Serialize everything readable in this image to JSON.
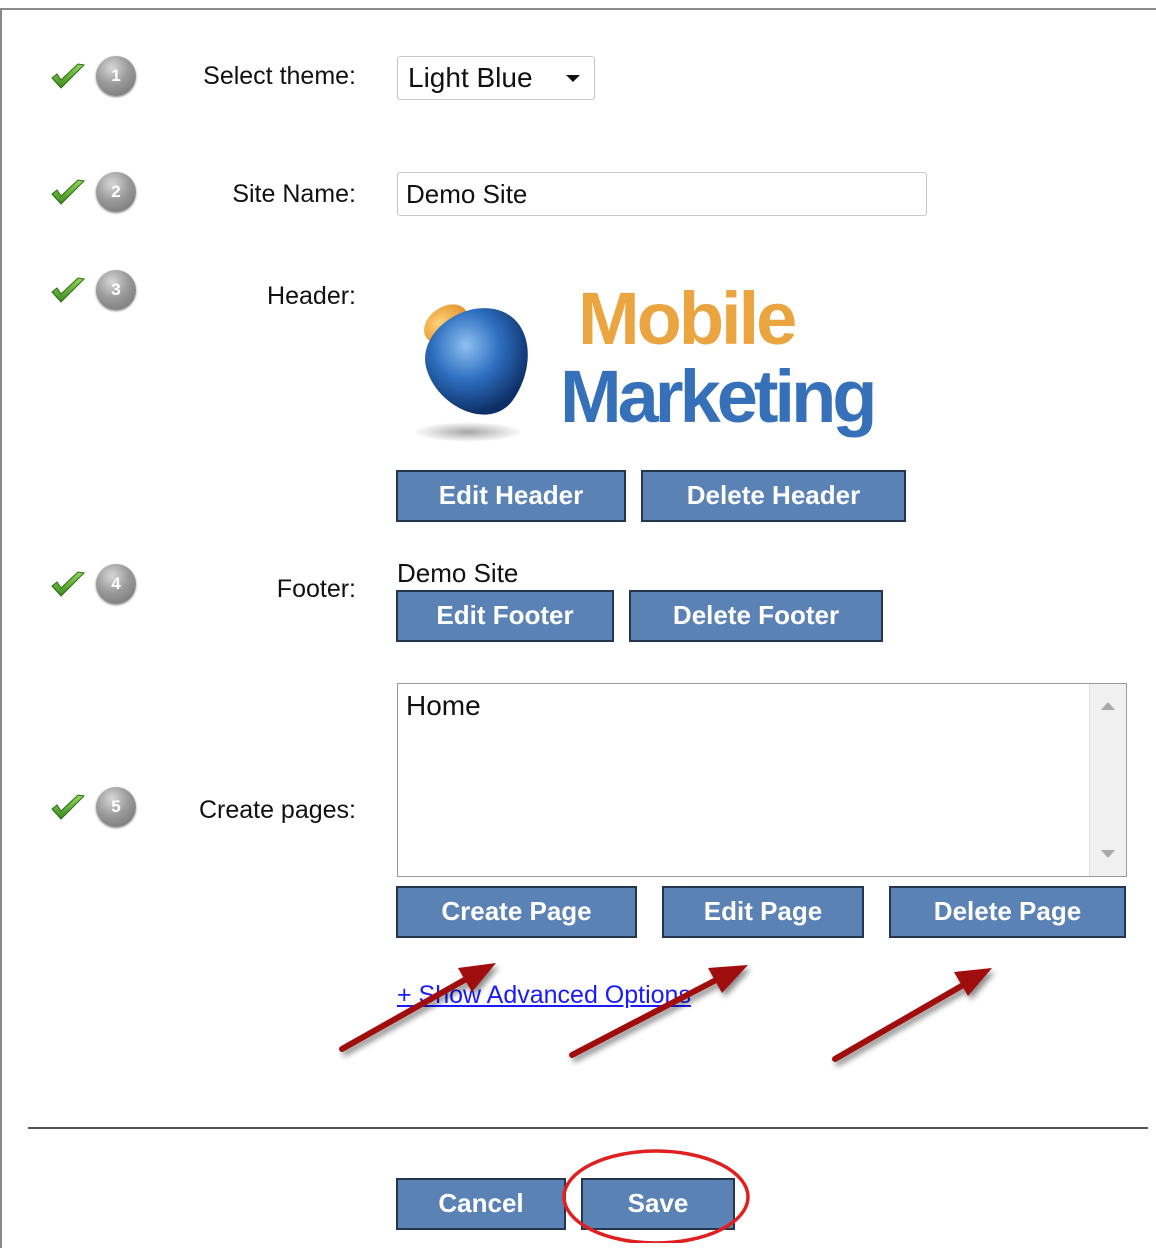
{
  "form": {
    "steps": [
      {
        "number": "1",
        "label": "Select theme:"
      },
      {
        "number": "2",
        "label": "Site Name:"
      },
      {
        "number": "3",
        "label": "Header:"
      },
      {
        "number": "4",
        "label": "Footer:"
      },
      {
        "number": "5",
        "label": "Create pages:"
      }
    ],
    "theme": {
      "selected": "Light Blue"
    },
    "site_name": {
      "value": "Demo Site"
    },
    "header": {
      "logo_text_line1": "Mobile",
      "logo_text_line2": "Marketing",
      "edit_label": "Edit Header",
      "delete_label": "Delete Header"
    },
    "footer": {
      "text": "Demo Site",
      "edit_label": "Edit Footer",
      "delete_label": "Delete Footer"
    },
    "pages": {
      "items": [
        "Home"
      ],
      "create_label": "Create Page",
      "edit_label": "Edit Page",
      "delete_label": "Delete Page"
    },
    "advanced_link": "+ Show Advanced Options",
    "cancel_label": "Cancel",
    "save_label": "Save"
  },
  "colors": {
    "button_bg": "#5a82b4",
    "button_border": "#24364f",
    "check_green": "#5aa832",
    "arrow_red": "#a01010",
    "circle_red": "#e02020",
    "link_blue": "#1a1aff"
  }
}
